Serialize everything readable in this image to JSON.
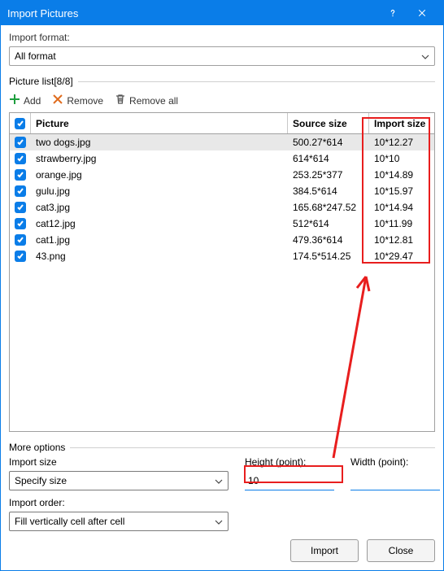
{
  "title": "Import Pictures",
  "import_format_label": "Import format:",
  "format_value": "All format",
  "picture_list_label": "Picture list[8/8]",
  "toolbar": {
    "add": "Add",
    "remove": "Remove",
    "remove_all": "Remove all"
  },
  "columns": {
    "picture": "Picture",
    "source": "Source size",
    "import_sz": "Import size"
  },
  "rows": [
    {
      "name": "two dogs.jpg",
      "source": "500.27*614",
      "import": "10*12.27",
      "selected": true
    },
    {
      "name": "strawberry.jpg",
      "source": "614*614",
      "import": "10*10",
      "selected": false
    },
    {
      "name": "orange.jpg",
      "source": "253.25*377",
      "import": "10*14.89",
      "selected": false
    },
    {
      "name": "gulu.jpg",
      "source": "384.5*614",
      "import": "10*15.97",
      "selected": false
    },
    {
      "name": "cat3.jpg",
      "source": "165.68*247.52",
      "import": "10*14.94",
      "selected": false
    },
    {
      "name": "cat12.jpg",
      "source": "512*614",
      "import": "10*11.99",
      "selected": false
    },
    {
      "name": "cat1.jpg",
      "source": "479.36*614",
      "import": "10*12.81",
      "selected": false
    },
    {
      "name": "43.png",
      "source": "174.5*514.25",
      "import": "10*29.47",
      "selected": false
    }
  ],
  "more_options_label": "More options",
  "import_size_label": "Import size",
  "import_size_value": "Specify size",
  "height_label": "Height (point):",
  "height_value": "10",
  "width_label": "Width (point):",
  "width_value": "",
  "import_order_label": "Import order:",
  "import_order_value": "Fill vertically cell after cell",
  "buttons": {
    "import": "Import",
    "close": "Close"
  }
}
